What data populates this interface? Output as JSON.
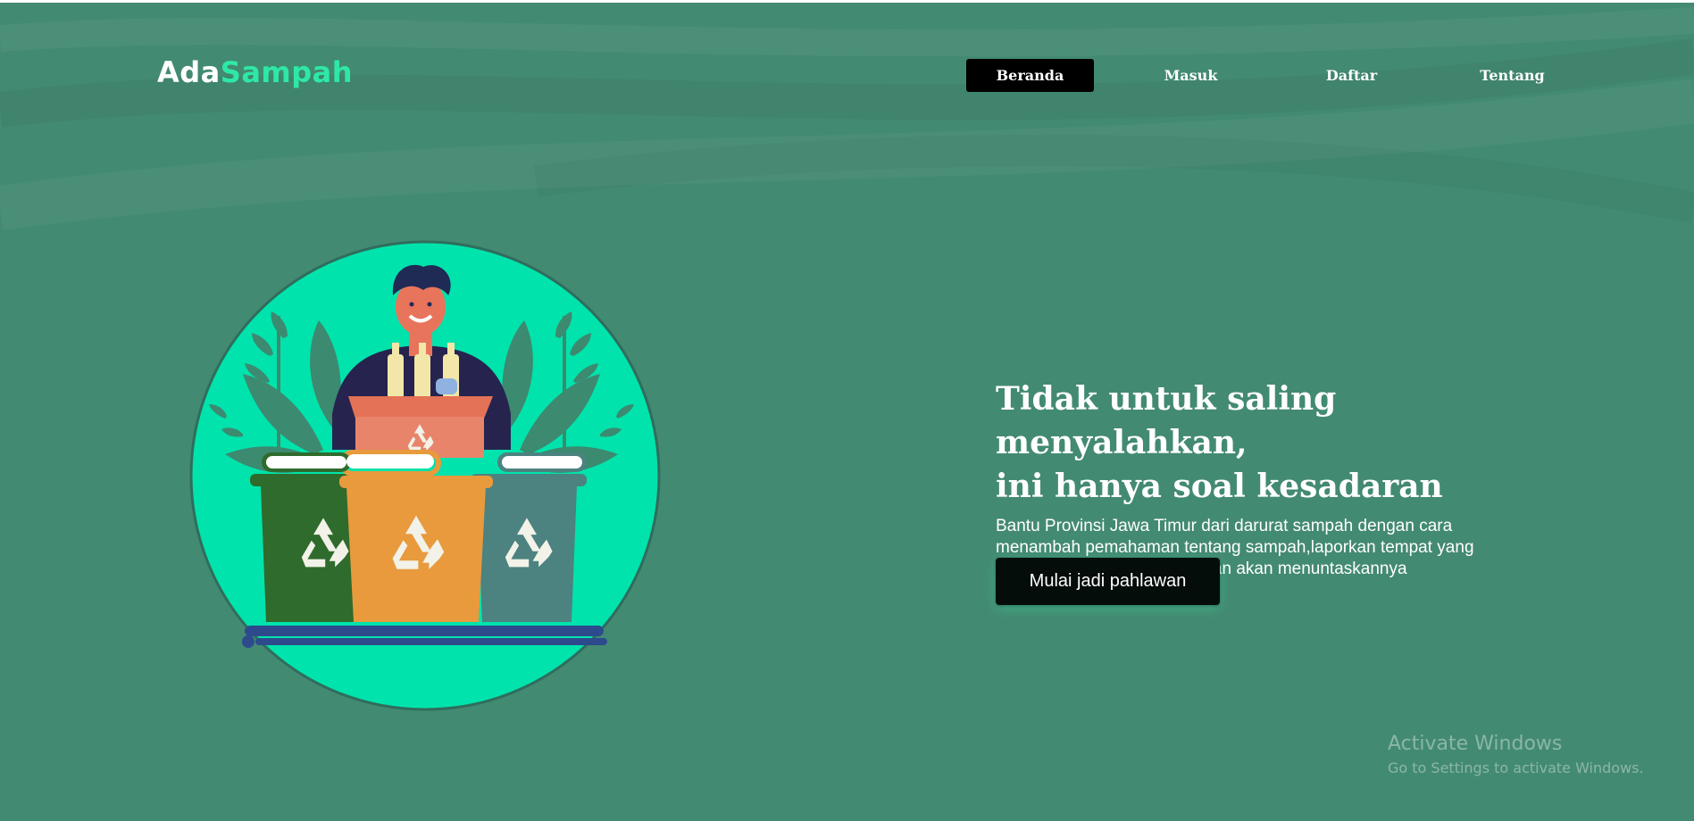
{
  "brand": {
    "logo_part_1": "Ada",
    "logo_part_2": "Sampah",
    "accent_color": "#2ee8a6",
    "background_color": "#438a72"
  },
  "nav": {
    "items": [
      {
        "label": "Beranda",
        "active": true
      },
      {
        "label": "Masuk",
        "active": false
      },
      {
        "label": "Daftar",
        "active": false
      },
      {
        "label": "Tentang",
        "active": false
      }
    ]
  },
  "hero": {
    "title_line_1": "Tidak untuk saling menyalahkan,",
    "title_line_2": "ini hanya soal kesadaran",
    "description": "Bantu Provinsi Jawa Timur dari darurat sampah dengan cara menambah pemahaman tentang sampah,laporkan tempat yang kotor dan pahlawan kebersihan akan menuntaskannya",
    "cta_label": "Mulai jadi pahlawan"
  },
  "illustration": {
    "icon": "recycling-bins-illustration",
    "circle_color": "#00e3ac",
    "bin_colors": [
      "#2e6b2c",
      "#e89a3d",
      "#4c8280"
    ]
  },
  "system_watermark": {
    "title": "Activate Windows",
    "subtitle": "Go to Settings to activate Windows."
  }
}
